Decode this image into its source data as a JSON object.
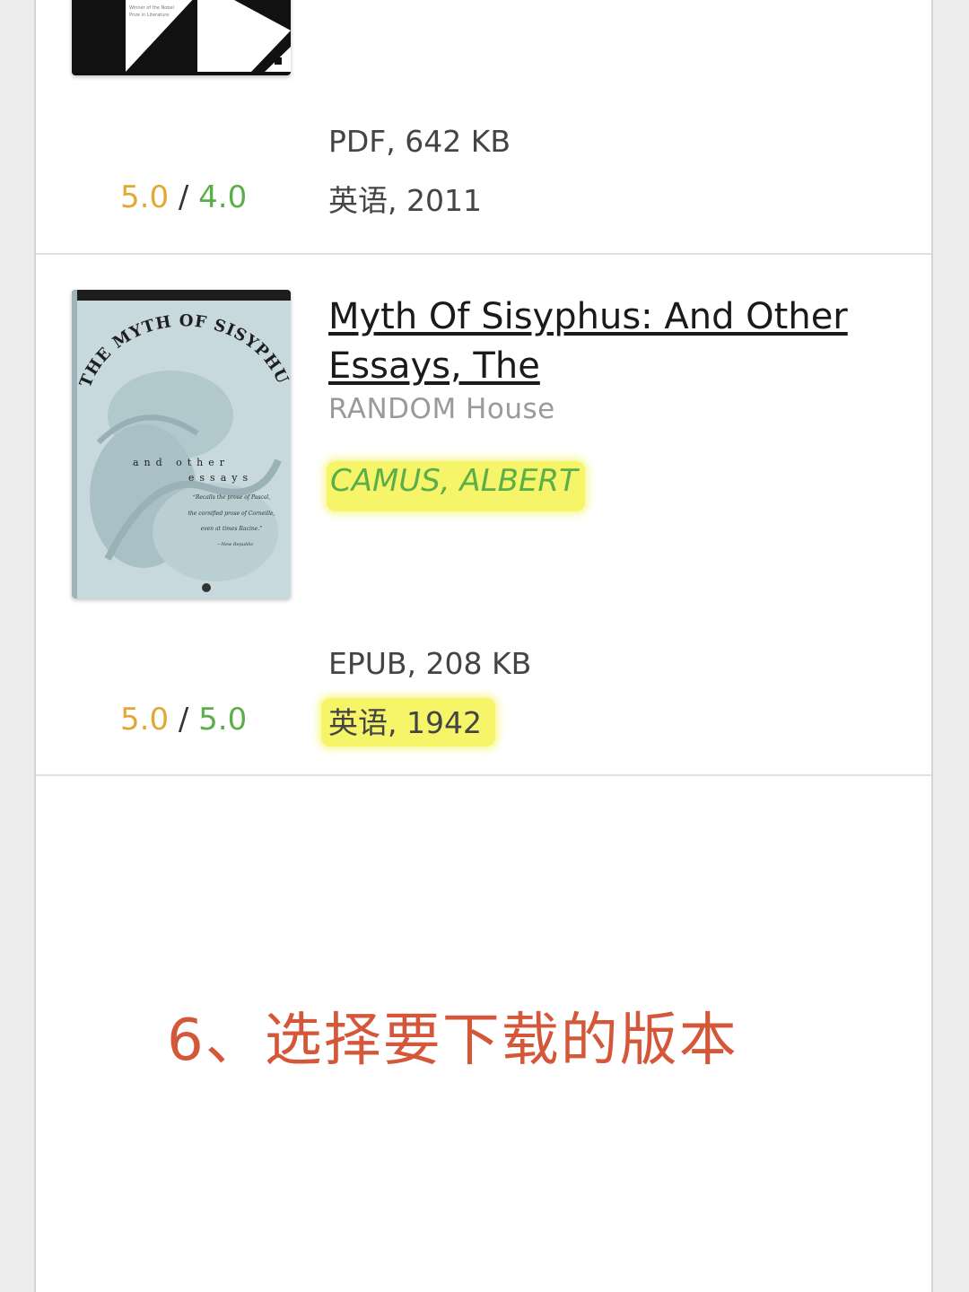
{
  "book1": {
    "rating_a": "5.0",
    "rating_sep": "/",
    "rating_b": "4.0",
    "format": "PDF, 642 KB",
    "lang_year": "英语, 2011",
    "cover_lines": [
      "Winner of the Nobel",
      "Prize in Literature"
    ]
  },
  "book2": {
    "title": "Myth Of Sisyphus: And Other Essays, The",
    "publisher": "RANDOM House",
    "author": "CAMUS, ALBERT",
    "rating_a": "5.0",
    "rating_sep": "/",
    "rating_b": "5.0",
    "format": "EPUB, 208 KB",
    "lang_year": "英语, 1942",
    "cover": {
      "title_arc": "THE MYTH OF SISYPHUS",
      "subtitle_1": "and other",
      "subtitle_2": "essays",
      "quote_1": "“Recalls the prose of Pascal,",
      "quote_2": "the cornified prose of Corneille,",
      "quote_3": "even at times Racine.”",
      "quote_source": "—New Republic"
    }
  },
  "caption": "6、选择要下载的版本",
  "colors": {
    "rating_user": "#e2a835",
    "rating_quality": "#5cae49",
    "highlight": "#f6f56a",
    "caption": "#d5573a"
  }
}
